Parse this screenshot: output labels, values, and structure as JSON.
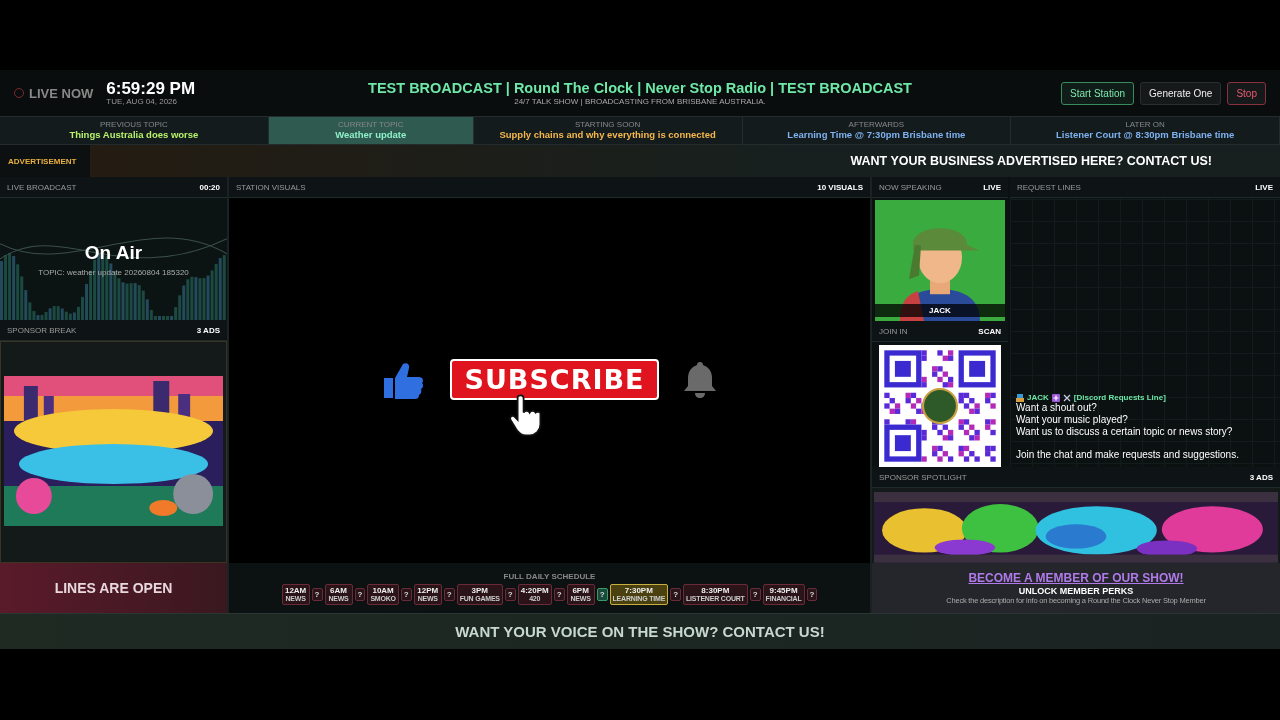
{
  "header": {
    "live_label": "LIVE NOW",
    "time": "6:59:29 PM",
    "date": "TUE, AUG 04, 2026",
    "title": "TEST BROADCAST | Round The Clock | Never Stop Radio | TEST BROADCAST",
    "subtitle": "24/7 TALK SHOW | BROADCASTING FROM BRISBANE AUSTRALIA.",
    "buttons": [
      {
        "label": "Start Station",
        "kind": "start"
      },
      {
        "label": "Generate One",
        "kind": "neutral"
      },
      {
        "label": "Stop",
        "kind": "stop"
      }
    ]
  },
  "topics": [
    {
      "caption": "PREVIOUS TOPIC",
      "title": "Things Australia does worse",
      "selected": false,
      "color": "#b8f26a"
    },
    {
      "caption": "CURRENT TOPIC",
      "title": "Weather update",
      "selected": true,
      "color": "#8ff0c8"
    },
    {
      "caption": "STARTING SOON",
      "title": "Supply chains and why everything is connected",
      "selected": false,
      "color": "#f5b84a"
    },
    {
      "caption": "AFTERWARDS",
      "title": "Learning Time @ 7:30pm Brisbane time",
      "selected": false,
      "color": "#7fb2f0"
    },
    {
      "caption": "LATER ON",
      "title": "Listener Court @ 8:30pm Brisbane time",
      "selected": false,
      "color": "#7fb2f0"
    }
  ],
  "ad_bar": {
    "label": "ADVERTISEMENT",
    "text": "WANT YOUR BUSINESS ADVERTISED HERE? CONTACT US!"
  },
  "live_broadcast": {
    "title": "LIVE BROADCAST",
    "timer": "00:20",
    "status": "On Air",
    "topic": "TOPIC: weather update 20260804 185320"
  },
  "sponsor_break": {
    "title": "SPONSOR BREAK",
    "count": "3 ADS"
  },
  "station_visuals": {
    "title": "STATION VISUALS",
    "count": "10 VISUALS",
    "subscribe": "SUBSCRIBE"
  },
  "now_speaking": {
    "title": "NOW SPEAKING",
    "badge": "LIVE",
    "name": "JACK"
  },
  "join_in": {
    "title": "JOIN IN",
    "badge": "SCAN"
  },
  "request_lines": {
    "title": "REQUEST LINES",
    "badge": "LIVE",
    "author": "JACK",
    "channel": "[Discord Requests Line]",
    "lines": [
      "Want a shout out?",
      "Want your music played?",
      "Want us to discuss a certain topic or news story?"
    ],
    "closing": "Join the chat and make requests and suggestions."
  },
  "sponsor_spotlight": {
    "title": "SPONSOR SPOTLIGHT",
    "count": "3 ADS"
  },
  "lines_open": "LINES ARE OPEN",
  "schedule": {
    "title": "FULL DAILY SCHEDULE",
    "items": [
      {
        "time": "12AM",
        "label": "NEWS",
        "selected": false,
        "badge": "?",
        "badge_on": false
      },
      {
        "time": "6AM",
        "label": "NEWS",
        "selected": false,
        "badge": "?",
        "badge_on": false
      },
      {
        "time": "10AM",
        "label": "SMOKO",
        "selected": false,
        "badge": "?",
        "badge_on": false
      },
      {
        "time": "12PM",
        "label": "NEWS",
        "selected": false,
        "badge": "?",
        "badge_on": false
      },
      {
        "time": "3PM",
        "label": "FUN GAMES",
        "selected": false,
        "badge": "?",
        "badge_on": false
      },
      {
        "time": "4:20PM",
        "label": "420",
        "selected": false,
        "badge": "?",
        "badge_on": false
      },
      {
        "time": "6PM",
        "label": "NEWS",
        "selected": false,
        "badge": "?",
        "badge_on": true
      },
      {
        "time": "7:30PM",
        "label": "LEARNING TIME",
        "selected": true,
        "badge": "?",
        "badge_on": false
      },
      {
        "time": "8:30PM",
        "label": "LISTENER COURT",
        "selected": false,
        "badge": "?",
        "badge_on": false
      },
      {
        "time": "9:45PM",
        "label": "FINANCIAL",
        "selected": false,
        "badge": "?",
        "badge_on": false
      }
    ]
  },
  "member": {
    "link": "BECOME A MEMBER OF OUR SHOW!",
    "heading": "UNLOCK MEMBER PERKS",
    "note": "Check the description for info on becoming a Round the Clock Never Stop Member"
  },
  "footer": "WANT YOUR VOICE ON THE SHOW? CONTACT US!"
}
